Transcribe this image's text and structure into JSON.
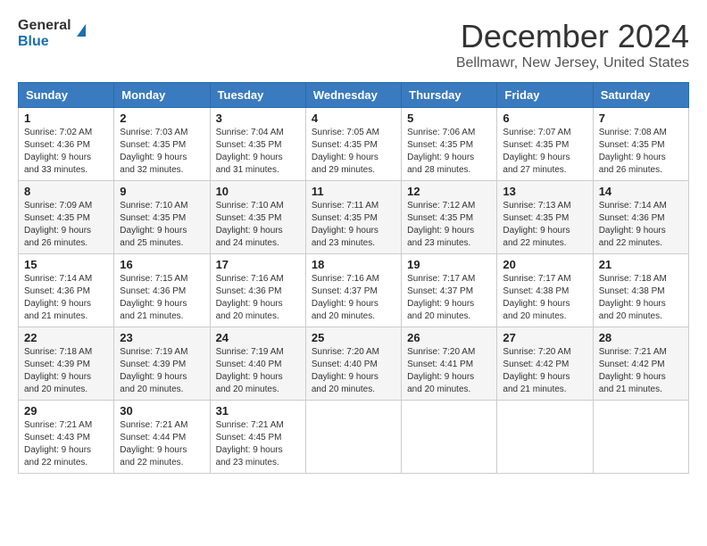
{
  "logo": {
    "line1": "General",
    "line2": "Blue"
  },
  "title": "December 2024",
  "subtitle": "Bellmawr, New Jersey, United States",
  "headers": [
    "Sunday",
    "Monday",
    "Tuesday",
    "Wednesday",
    "Thursday",
    "Friday",
    "Saturday"
  ],
  "weeks": [
    [
      {
        "day": "1",
        "sunrise": "7:02 AM",
        "sunset": "4:36 PM",
        "daylight": "9 hours and 33 minutes."
      },
      {
        "day": "2",
        "sunrise": "7:03 AM",
        "sunset": "4:35 PM",
        "daylight": "9 hours and 32 minutes."
      },
      {
        "day": "3",
        "sunrise": "7:04 AM",
        "sunset": "4:35 PM",
        "daylight": "9 hours and 31 minutes."
      },
      {
        "day": "4",
        "sunrise": "7:05 AM",
        "sunset": "4:35 PM",
        "daylight": "9 hours and 29 minutes."
      },
      {
        "day": "5",
        "sunrise": "7:06 AM",
        "sunset": "4:35 PM",
        "daylight": "9 hours and 28 minutes."
      },
      {
        "day": "6",
        "sunrise": "7:07 AM",
        "sunset": "4:35 PM",
        "daylight": "9 hours and 27 minutes."
      },
      {
        "day": "7",
        "sunrise": "7:08 AM",
        "sunset": "4:35 PM",
        "daylight": "9 hours and 26 minutes."
      }
    ],
    [
      {
        "day": "8",
        "sunrise": "7:09 AM",
        "sunset": "4:35 PM",
        "daylight": "9 hours and 26 minutes."
      },
      {
        "day": "9",
        "sunrise": "7:10 AM",
        "sunset": "4:35 PM",
        "daylight": "9 hours and 25 minutes."
      },
      {
        "day": "10",
        "sunrise": "7:10 AM",
        "sunset": "4:35 PM",
        "daylight": "9 hours and 24 minutes."
      },
      {
        "day": "11",
        "sunrise": "7:11 AM",
        "sunset": "4:35 PM",
        "daylight": "9 hours and 23 minutes."
      },
      {
        "day": "12",
        "sunrise": "7:12 AM",
        "sunset": "4:35 PM",
        "daylight": "9 hours and 23 minutes."
      },
      {
        "day": "13",
        "sunrise": "7:13 AM",
        "sunset": "4:35 PM",
        "daylight": "9 hours and 22 minutes."
      },
      {
        "day": "14",
        "sunrise": "7:14 AM",
        "sunset": "4:36 PM",
        "daylight": "9 hours and 22 minutes."
      }
    ],
    [
      {
        "day": "15",
        "sunrise": "7:14 AM",
        "sunset": "4:36 PM",
        "daylight": "9 hours and 21 minutes."
      },
      {
        "day": "16",
        "sunrise": "7:15 AM",
        "sunset": "4:36 PM",
        "daylight": "9 hours and 21 minutes."
      },
      {
        "day": "17",
        "sunrise": "7:16 AM",
        "sunset": "4:36 PM",
        "daylight": "9 hours and 20 minutes."
      },
      {
        "day": "18",
        "sunrise": "7:16 AM",
        "sunset": "4:37 PM",
        "daylight": "9 hours and 20 minutes."
      },
      {
        "day": "19",
        "sunrise": "7:17 AM",
        "sunset": "4:37 PM",
        "daylight": "9 hours and 20 minutes."
      },
      {
        "day": "20",
        "sunrise": "7:17 AM",
        "sunset": "4:38 PM",
        "daylight": "9 hours and 20 minutes."
      },
      {
        "day": "21",
        "sunrise": "7:18 AM",
        "sunset": "4:38 PM",
        "daylight": "9 hours and 20 minutes."
      }
    ],
    [
      {
        "day": "22",
        "sunrise": "7:18 AM",
        "sunset": "4:39 PM",
        "daylight": "9 hours and 20 minutes."
      },
      {
        "day": "23",
        "sunrise": "7:19 AM",
        "sunset": "4:39 PM",
        "daylight": "9 hours and 20 minutes."
      },
      {
        "day": "24",
        "sunrise": "7:19 AM",
        "sunset": "4:40 PM",
        "daylight": "9 hours and 20 minutes."
      },
      {
        "day": "25",
        "sunrise": "7:20 AM",
        "sunset": "4:40 PM",
        "daylight": "9 hours and 20 minutes."
      },
      {
        "day": "26",
        "sunrise": "7:20 AM",
        "sunset": "4:41 PM",
        "daylight": "9 hours and 20 minutes."
      },
      {
        "day": "27",
        "sunrise": "7:20 AM",
        "sunset": "4:42 PM",
        "daylight": "9 hours and 21 minutes."
      },
      {
        "day": "28",
        "sunrise": "7:21 AM",
        "sunset": "4:42 PM",
        "daylight": "9 hours and 21 minutes."
      }
    ],
    [
      {
        "day": "29",
        "sunrise": "7:21 AM",
        "sunset": "4:43 PM",
        "daylight": "9 hours and 22 minutes."
      },
      {
        "day": "30",
        "sunrise": "7:21 AM",
        "sunset": "4:44 PM",
        "daylight": "9 hours and 22 minutes."
      },
      {
        "day": "31",
        "sunrise": "7:21 AM",
        "sunset": "4:45 PM",
        "daylight": "9 hours and 23 minutes."
      },
      null,
      null,
      null,
      null
    ]
  ],
  "labels": {
    "sunrise": "Sunrise:",
    "sunset": "Sunset:",
    "daylight": "Daylight:"
  }
}
